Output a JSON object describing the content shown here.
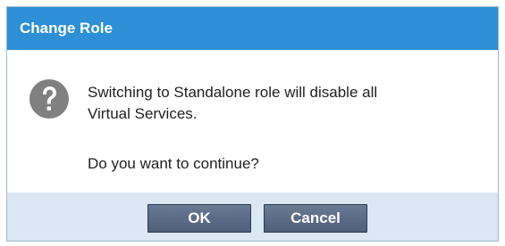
{
  "dialog": {
    "title": "Change Role",
    "icon": "question-icon",
    "message_lines": [
      "Switching to Standalone role will disable all",
      "Virtual Services."
    ],
    "question": "Do you want to continue?",
    "buttons": {
      "ok_label": "OK",
      "cancel_label": "Cancel"
    },
    "colors": {
      "title_bar": "#2d8fd6",
      "footer": "#dbe7f2",
      "button": "#5b6b85",
      "icon": "#808080"
    }
  }
}
